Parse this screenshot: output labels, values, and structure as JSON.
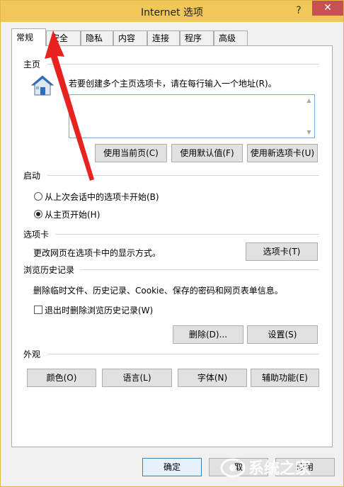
{
  "window": {
    "title": "Internet 选项",
    "help_label": "?",
    "close_label": "✕"
  },
  "tabs": [
    {
      "label": "常规"
    },
    {
      "label": "安全"
    },
    {
      "label": "隐私"
    },
    {
      "label": "内容"
    },
    {
      "label": "连接"
    },
    {
      "label": "程序"
    },
    {
      "label": "高级"
    }
  ],
  "homepage": {
    "group_label": "主页",
    "instruction": "若要创建多个主页选项卡，请在每行输入一个地址(R)。",
    "value": "",
    "use_current_label": "使用当前页(C)",
    "use_default_label": "使用默认值(F)",
    "use_new_tab_label": "使用新选项卡(U)"
  },
  "startup": {
    "group_label": "启动",
    "option_last_session": "从上次会话中的选项卡开始(B)",
    "option_home_page": "从主页开始(H)",
    "selected": "option_home_page"
  },
  "tabs_group": {
    "group_label": "选项卡",
    "description": "更改网页在选项卡中的显示方式。",
    "button_label": "选项卡(T)"
  },
  "history": {
    "group_label": "浏览历史记录",
    "description": "删除临时文件、历史记录、Cookie、保存的密码和网页表单信息。",
    "delete_on_exit_label": "退出时删除浏览历史记录(W)",
    "delete_on_exit_checked": false,
    "delete_button_label": "删除(D)...",
    "settings_button_label": "设置(S)"
  },
  "appearance": {
    "group_label": "外观",
    "colors_label": "颜色(O)",
    "languages_label": "语言(L)",
    "fonts_label": "字体(N)",
    "accessibility_label": "辅助功能(E)"
  },
  "footer": {
    "ok_label": "确定",
    "cancel_label": "取",
    "apply_label": "应用"
  },
  "watermark": {
    "text": "系统之家"
  },
  "colors": {
    "titlebar": "#f1c75a",
    "close_button": "#c75050",
    "annotation_arrow": "#e8231f",
    "home_icon_blue": "#2a6fc2"
  }
}
